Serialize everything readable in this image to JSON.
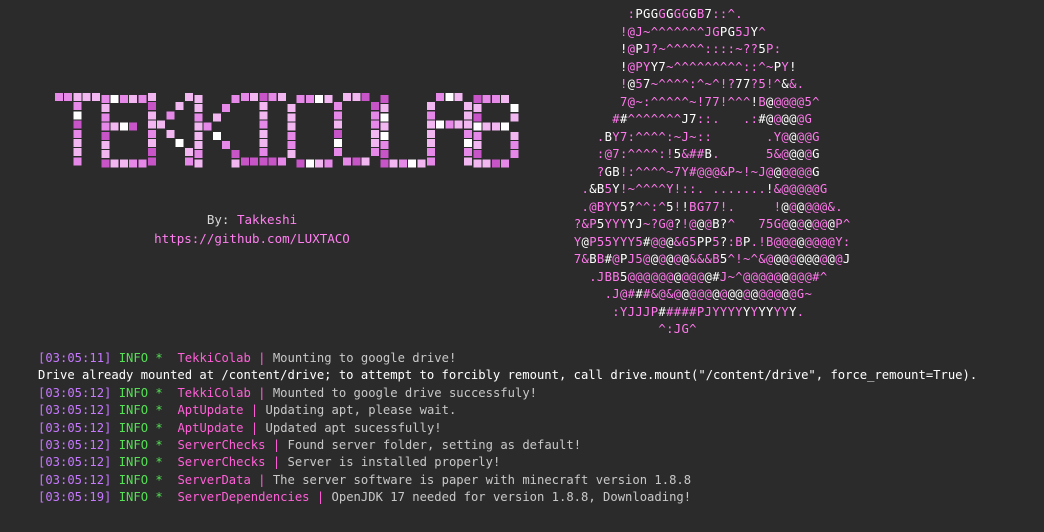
{
  "brand": {
    "logo_text": "TEKKICOLAB",
    "by_label": "By:",
    "author": "Takkeshi",
    "github_url": "https://github.com/LUXTACO"
  },
  "ascii_art": [
    "              :PGGGGGGGB7::^.",
    "             !@J~^^^^^^^JGPG5JY^",
    "             !@PJ?~^^^^^::::~??5P:",
    "             !@PYY7~^^^^^^^^^::^~PY!",
    "             !@57~^^^^:^~^!?77?5!^&&.",
    "             7@~:^^^^^~!77!^^^!B@@@@@5^",
    "            ##^^^^^^^J7::.   .:#@@@@@G",
    "          .BY7:^^^^:~J~::       .Y@@@@G",
    "          :@7:^^^^:!5&##B.      5&@@@@G",
    "          ?GB!:^^^^~7Y#@@@&P~!~J@@@@@@G",
    "        .&B5Y!~^^^^Y!::. .......!&@@@@@G",
    "        .@BYY5?^^:^5!!BG77!.     !@@@@@@&.",
    "       ?&P5YYYYJ~?G@?!@@@B?^   75G@@@@@@@P^",
    "       Y@P55YYY5#@@@&G5PP5?:BP.!B@@@@@@@@Y:",
    "       7&BB#@PJ5@@@@@@&&&B5^!~^&@@@@@@@@@@J",
    "         .JBB5@@@@@@@@@@@#J~^@@@@@@@@@#^",
    "           .J@###&@&@@@@@@@@@@@@@@@@G~",
    "            :YJJJP#####PJYYYYYYYYYYY.",
    "                  ^:JG^"
  ],
  "drive_notice": "Drive already mounted at /content/drive; to attempt to forcibly remount, call drive.mount(\"/content/drive\", force_remount=True).",
  "logs": [
    {
      "time": "[03:05:11]",
      "level": "INFO *",
      "source": "TekkiColab",
      "message": "Mounting to google drive!"
    },
    {
      "time": "[03:05:12]",
      "level": "INFO *",
      "source": "TekkiColab",
      "message": "Mounted to google drive successfuly!"
    },
    {
      "time": "[03:05:12]",
      "level": "INFO *",
      "source": "AptUpdate",
      "message": "Updating apt, please wait."
    },
    {
      "time": "[03:05:12]",
      "level": "INFO *",
      "source": "AptUpdate",
      "message": "Updated apt sucessfully!"
    },
    {
      "time": "[03:05:12]",
      "level": "INFO *",
      "source": "ServerChecks",
      "message": "Found server folder, setting as default!"
    },
    {
      "time": "[03:05:12]",
      "level": "INFO *",
      "source": "ServerChecks",
      "message": "Server is installed properly!"
    },
    {
      "time": "[03:05:12]",
      "level": "INFO *",
      "source": "ServerData",
      "message": "The server software is paper with minecraft version 1.8.8"
    },
    {
      "time": "[03:05:19]",
      "level": "INFO *",
      "source": "ServerDependencies",
      "message": "OpenJDK 17 needed for version 1.8.8, Downloading!"
    }
  ],
  "colors": {
    "background": "#2b2b2b",
    "pink": "#ff60d8",
    "purple": "#c678ff",
    "green": "#55e055",
    "logo_light": "#f2b7f0",
    "logo_mid": "#e688e8",
    "logo_dark": "#c855c8"
  }
}
